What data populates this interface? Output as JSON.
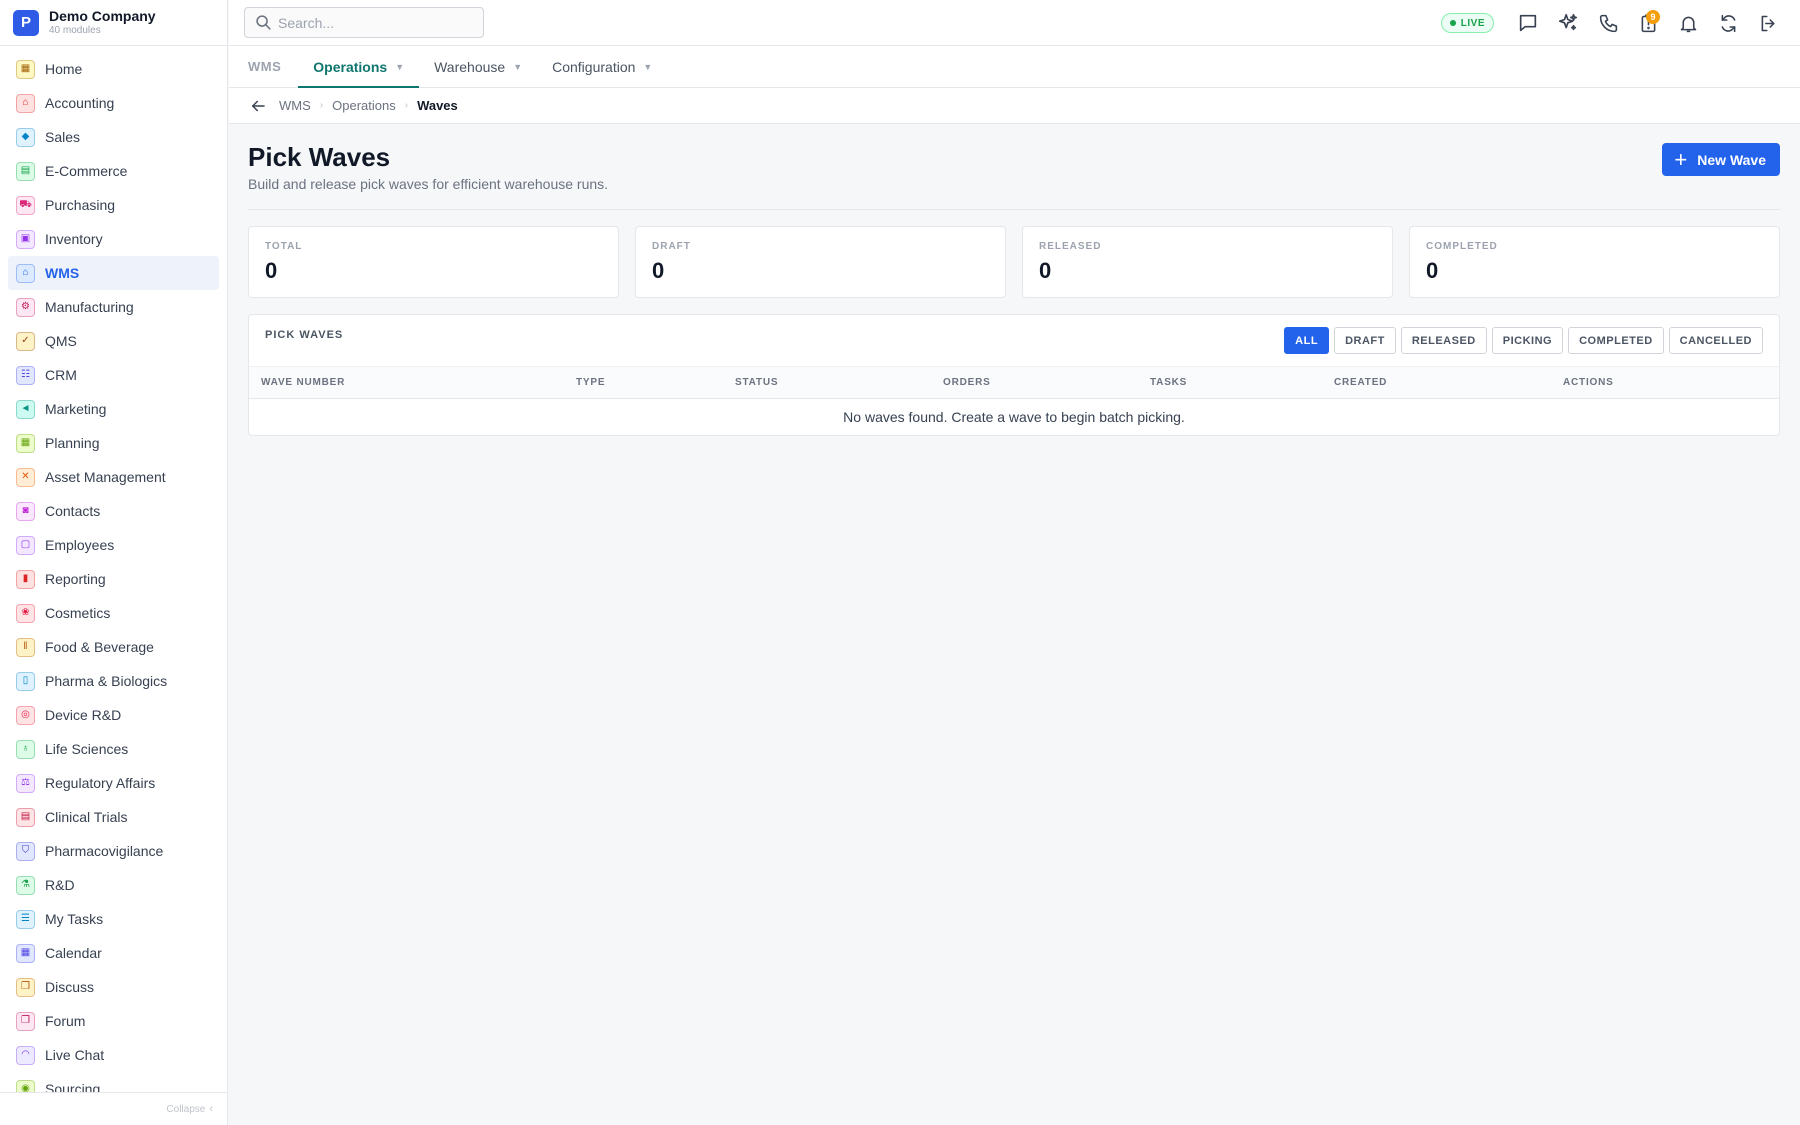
{
  "brand": {
    "logo_letter": "P",
    "name": "Demo Company",
    "subtitle": "40 modules"
  },
  "sidebar": {
    "items": [
      {
        "label": "Home",
        "icon": "grid-icon",
        "glyph": "▦",
        "color": "#a16207",
        "bg": "#fef9c3"
      },
      {
        "label": "Accounting",
        "icon": "bank-icon",
        "glyph": "⌂",
        "color": "#dc2626",
        "bg": "#fee2e2"
      },
      {
        "label": "Sales",
        "icon": "tag-icon",
        "glyph": "◆",
        "color": "#0284c7",
        "bg": "#e0f2fe"
      },
      {
        "label": "E-Commerce",
        "icon": "storefront-icon",
        "glyph": "▤",
        "color": "#16a34a",
        "bg": "#dcfce7"
      },
      {
        "label": "Purchasing",
        "icon": "cart-icon",
        "glyph": "⛟",
        "color": "#db2777",
        "bg": "#fce7f3"
      },
      {
        "label": "Inventory",
        "icon": "box-icon",
        "glyph": "▣",
        "color": "#9333ea",
        "bg": "#f3e8ff"
      },
      {
        "label": "WMS",
        "icon": "warehouse-icon",
        "glyph": "⌂",
        "color": "#2563eb",
        "bg": "#dbeafe",
        "active": true
      },
      {
        "label": "Manufacturing",
        "icon": "factory-icon",
        "glyph": "⚙",
        "color": "#be185d",
        "bg": "#fce7f3"
      },
      {
        "label": "QMS",
        "icon": "badge-check-icon",
        "glyph": "✓",
        "color": "#92400e",
        "bg": "#fef3c7"
      },
      {
        "label": "CRM",
        "icon": "users-icon",
        "glyph": "☷",
        "color": "#4f46e5",
        "bg": "#e0e7ff"
      },
      {
        "label": "Marketing",
        "icon": "megaphone-icon",
        "glyph": "◄",
        "color": "#0d9488",
        "bg": "#ccfbf1"
      },
      {
        "label": "Planning",
        "icon": "calendar-icon",
        "glyph": "▦",
        "color": "#65a30d",
        "bg": "#ecfccb"
      },
      {
        "label": "Asset Management",
        "icon": "tools-icon",
        "glyph": "✕",
        "color": "#ea580c",
        "bg": "#ffedd5"
      },
      {
        "label": "Contacts",
        "icon": "contact-card-icon",
        "glyph": "◙",
        "color": "#c026d3",
        "bg": "#fae8ff"
      },
      {
        "label": "Employees",
        "icon": "briefcase-icon",
        "glyph": "▢",
        "color": "#9333ea",
        "bg": "#f3e8ff"
      },
      {
        "label": "Reporting",
        "icon": "bar-chart-icon",
        "glyph": "▮",
        "color": "#dc2626",
        "bg": "#fee2e2"
      },
      {
        "label": "Cosmetics",
        "icon": "lotus-icon",
        "glyph": "❀",
        "color": "#e11d48",
        "bg": "#ffe4e6"
      },
      {
        "label": "Food & Beverage",
        "icon": "utensils-icon",
        "glyph": "ǁ",
        "color": "#b45309",
        "bg": "#fef3c7"
      },
      {
        "label": "Pharma & Biologics",
        "icon": "pill-bottle-icon",
        "glyph": "▯",
        "color": "#0284c7",
        "bg": "#e0f2fe"
      },
      {
        "label": "Device R&D",
        "icon": "chip-icon",
        "glyph": "◎",
        "color": "#e11d48",
        "bg": "#ffe4e6"
      },
      {
        "label": "Life Sciences",
        "icon": "microscope-icon",
        "glyph": "♁",
        "color": "#16a34a",
        "bg": "#dcfce7"
      },
      {
        "label": "Regulatory Affairs",
        "icon": "gavel-icon",
        "glyph": "⚖",
        "color": "#9333ea",
        "bg": "#f3e8ff"
      },
      {
        "label": "Clinical Trials",
        "icon": "clipboard-icon",
        "glyph": "▤",
        "color": "#be123c",
        "bg": "#ffe4e6"
      },
      {
        "label": "Pharmacovigilance",
        "icon": "shield-icon",
        "glyph": "⛉",
        "color": "#4338ca",
        "bg": "#e0e7ff"
      },
      {
        "label": "R&D",
        "icon": "flask-icon",
        "glyph": "⚗",
        "color": "#16a34a",
        "bg": "#dcfce7"
      },
      {
        "label": "My Tasks",
        "icon": "checklist-icon",
        "glyph": "☰",
        "color": "#0284c7",
        "bg": "#e0f2fe"
      },
      {
        "label": "Calendar",
        "icon": "calendar-icon",
        "glyph": "▦",
        "color": "#4f46e5",
        "bg": "#e0e7ff"
      },
      {
        "label": "Discuss",
        "icon": "chat-bubbles-icon",
        "glyph": "❐",
        "color": "#b45309",
        "bg": "#fef3c7"
      },
      {
        "label": "Forum",
        "icon": "forum-icon",
        "glyph": "❐",
        "color": "#be185d",
        "bg": "#fce7f3"
      },
      {
        "label": "Live Chat",
        "icon": "headset-icon",
        "glyph": "◠",
        "color": "#7c3aed",
        "bg": "#ede9fe"
      },
      {
        "label": "Sourcing",
        "icon": "sourcing-icon",
        "glyph": "◉",
        "color": "#65a30d",
        "bg": "#ecfccb"
      }
    ],
    "collapse_label": "Collapse"
  },
  "topbar": {
    "search_placeholder": "Search...",
    "live_label": "LIVE",
    "icons": [
      "chat-icon",
      "sparkles-icon",
      "phone-icon",
      "clipboard-alert-icon",
      "bell-icon",
      "sync-icon",
      "logout-icon"
    ],
    "badge_count": "9"
  },
  "module_tabs": {
    "module": "WMS",
    "tabs": [
      {
        "label": "Operations",
        "active": true
      },
      {
        "label": "Warehouse",
        "active": false
      },
      {
        "label": "Configuration",
        "active": false
      }
    ]
  },
  "breadcrumb": {
    "items": [
      "WMS",
      "Operations"
    ],
    "current": "Waves"
  },
  "page": {
    "title": "Pick Waves",
    "subtitle": "Build and release pick waves for efficient warehouse runs.",
    "new_button_label": "New Wave"
  },
  "stats": [
    {
      "label": "TOTAL",
      "value": "0"
    },
    {
      "label": "DRAFT",
      "value": "0"
    },
    {
      "label": "RELEASED",
      "value": "0"
    },
    {
      "label": "COMPLETED",
      "value": "0"
    }
  ],
  "panel": {
    "title": "PICK WAVES",
    "filters": [
      {
        "label": "ALL",
        "active": true
      },
      {
        "label": "DRAFT",
        "active": false
      },
      {
        "label": "RELEASED",
        "active": false
      },
      {
        "label": "PICKING",
        "active": false
      },
      {
        "label": "COMPLETED",
        "active": false
      },
      {
        "label": "CANCELLED",
        "active": false
      }
    ],
    "columns": [
      "WAVE NUMBER",
      "TYPE",
      "STATUS",
      "ORDERS",
      "TASKS",
      "CREATED",
      "ACTIONS"
    ],
    "empty_message": "No waves found. Create a wave to begin batch picking."
  },
  "colors": {
    "accent": "#2363eb",
    "active_tab": "#0f766e",
    "live_green": "#16a34a",
    "badge": "#f59e0b"
  }
}
